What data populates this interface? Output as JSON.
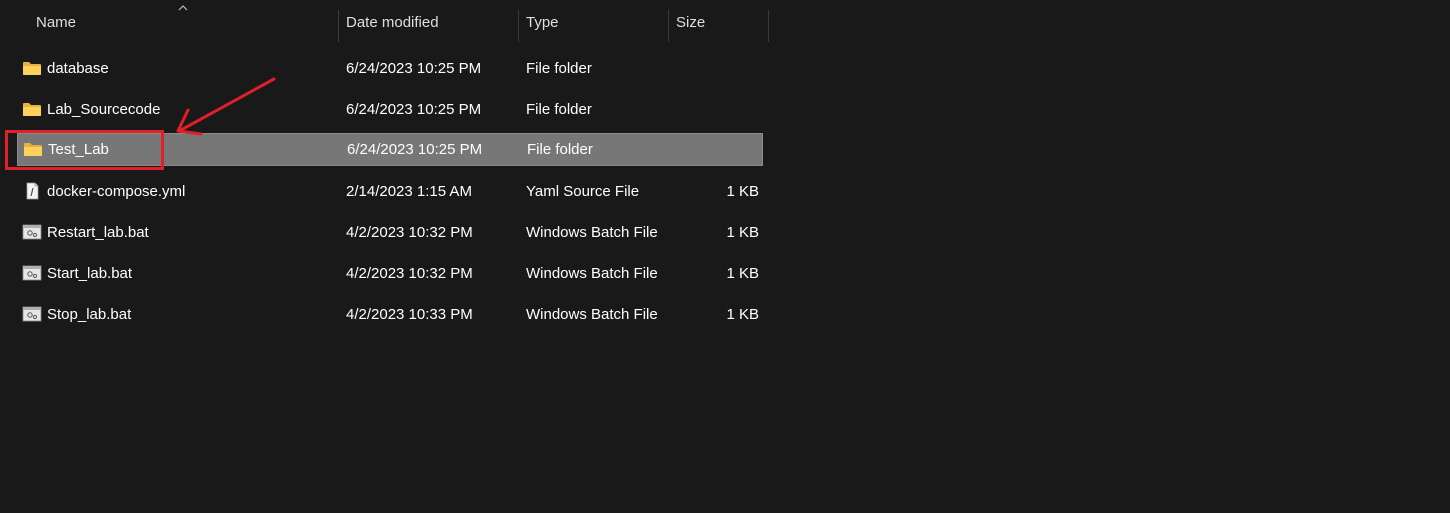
{
  "columns": {
    "name": "Name",
    "date_modified": "Date modified",
    "type": "Type",
    "size": "Size"
  },
  "rows": [
    {
      "name": "database",
      "date": "6/24/2023 10:25 PM",
      "type": "File folder",
      "size": "",
      "icon": "folder-icon"
    },
    {
      "name": "Lab_Sourcecode",
      "date": "6/24/2023 10:25 PM",
      "type": "File folder",
      "size": "",
      "icon": "folder-icon"
    },
    {
      "name": "Test_Lab",
      "date": "6/24/2023 10:25 PM",
      "type": "File folder",
      "size": "",
      "icon": "folder-icon",
      "selected": true
    },
    {
      "name": "docker-compose.yml",
      "date": "2/14/2023 1:15 AM",
      "type": "Yaml Source File",
      "size": "1 KB",
      "icon": "yaml-file-icon"
    },
    {
      "name": "Restart_lab.bat",
      "date": "4/2/2023 10:32 PM",
      "type": "Windows Batch File",
      "size": "1 KB",
      "icon": "batch-file-icon"
    },
    {
      "name": "Start_lab.bat",
      "date": "4/2/2023 10:32 PM",
      "type": "Windows Batch File",
      "size": "1 KB",
      "icon": "batch-file-icon"
    },
    {
      "name": "Stop_lab.bat",
      "date": "4/2/2023 10:33 PM",
      "type": "Windows Batch File",
      "size": "1 KB",
      "icon": "batch-file-icon"
    }
  ],
  "colors": {
    "background": "#191919",
    "selected_row": "#777777",
    "annotation": "#e01f2b"
  }
}
